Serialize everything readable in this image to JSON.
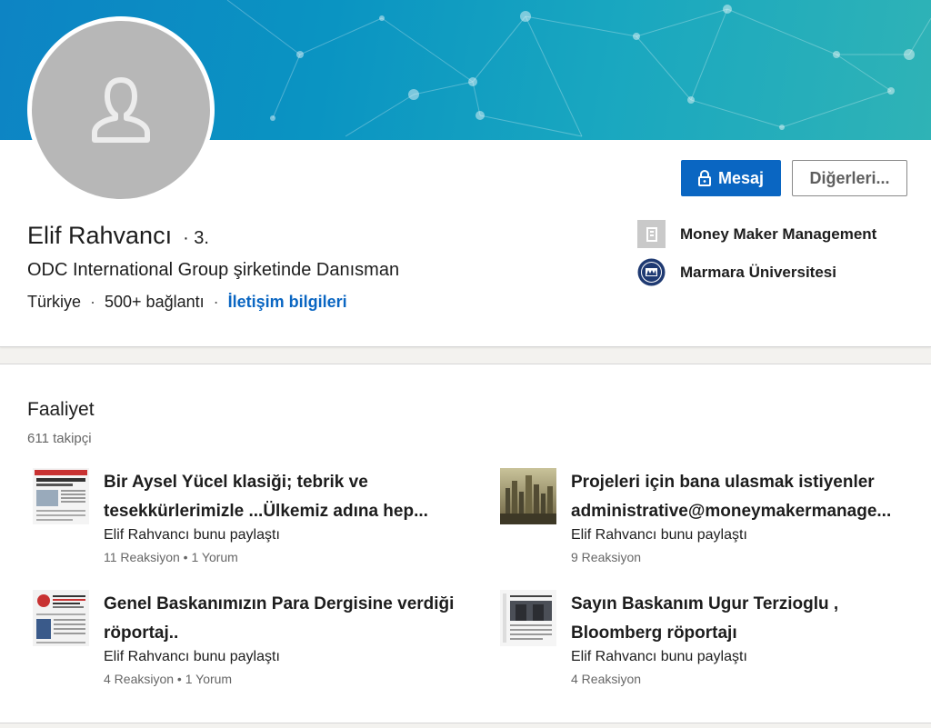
{
  "profile": {
    "name": "Elif Rahvancı",
    "degree": "· 3.",
    "headline": "ODC International Group şirketinde Danısman",
    "location": "Türkiye",
    "connections": "500+ bağlantı",
    "contact_link": "İletişim bilgileri",
    "separator": "·"
  },
  "actions": {
    "message_label": "Mesaj",
    "more_label": "Diğerleri..."
  },
  "organizations": [
    {
      "name": "Money Maker Management",
      "icon": "building-icon"
    },
    {
      "name": "Marmara Üniversitesi",
      "icon": "university-logo"
    }
  ],
  "activity": {
    "title": "Faaliyet",
    "followers": "611 takipçi",
    "posts": [
      {
        "title_line1": "Bir Aysel Yücel klasiği; tebrik ve",
        "title_line2": "tesekkürlerimizle ...Ülkemiz adına hep...",
        "sharer": "Elif Rahvancı bunu paylaştı",
        "stats": "11 Reaksiyon • 1 Yorum"
      },
      {
        "title_line1": "Projeleri için bana ulasmak istiyenler",
        "title_line2": "administrative@moneymakermanage...",
        "sharer": "Elif Rahvancı bunu paylaştı",
        "stats": "9 Reaksiyon"
      },
      {
        "title_line1": "Genel Baskanımızın Para Dergisine verdiği",
        "title_line2": "röportaj..",
        "sharer": "Elif Rahvancı bunu paylaştı",
        "stats": "4 Reaksiyon • 1 Yorum"
      },
      {
        "title_line1": "Sayın Baskanım Ugur Terzioglu ,",
        "title_line2": "Bloomberg röportajı",
        "sharer": "Elif Rahvancı bunu paylaştı",
        "stats": "4 Reaksiyon"
      }
    ]
  },
  "colors": {
    "accent": "#0a66c2",
    "banner_start": "#0d84c4",
    "banner_end": "#2fb3b6"
  }
}
